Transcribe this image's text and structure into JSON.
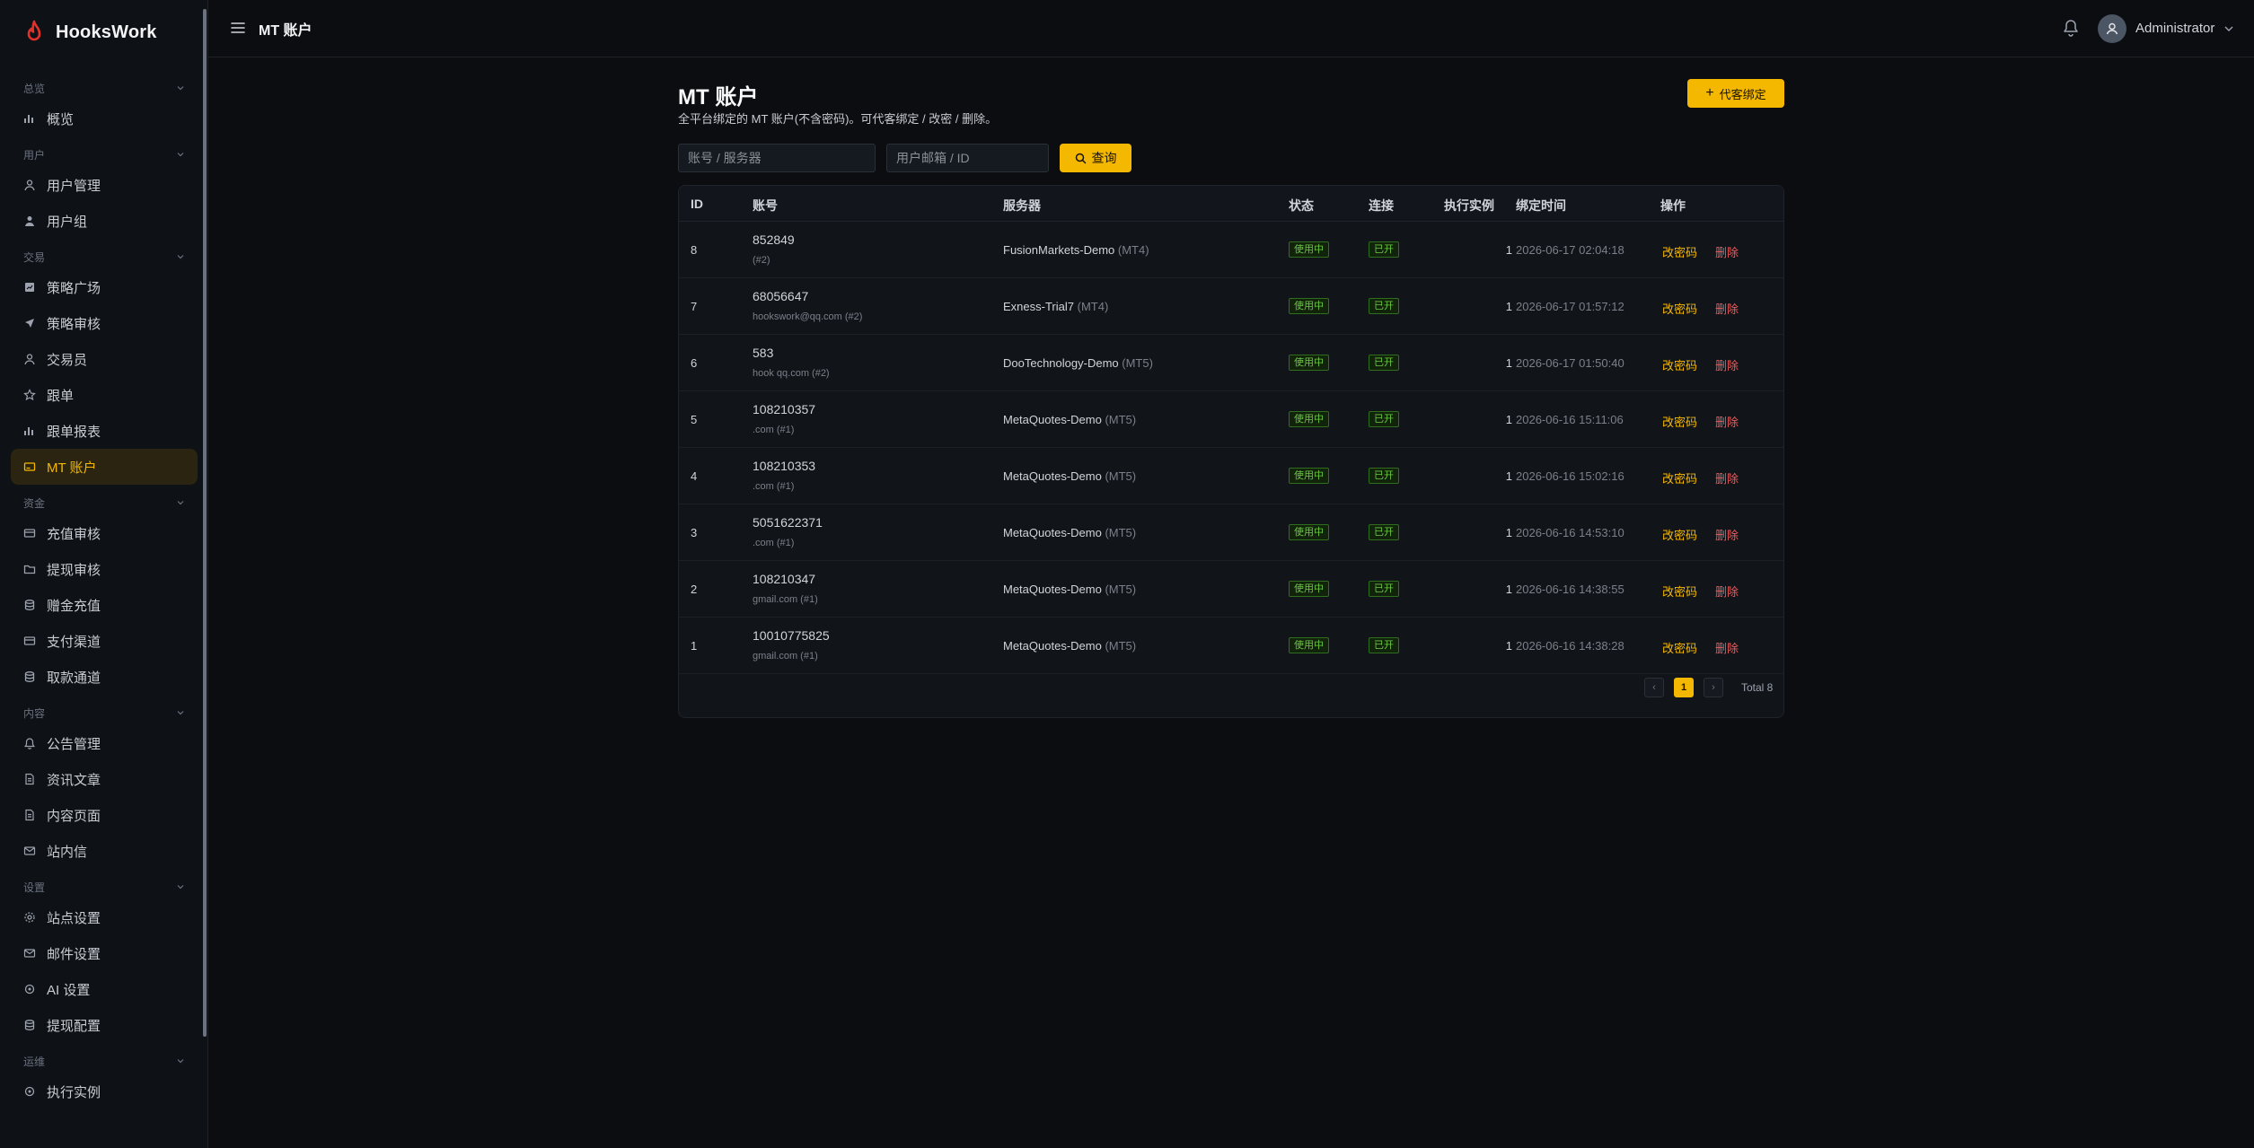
{
  "brand": {
    "name": "HooksWork"
  },
  "header": {
    "title": "MT 账户",
    "user": "Administrator"
  },
  "sidebar": {
    "groups": [
      {
        "title": "总览",
        "items": [
          {
            "label": "概览",
            "icon": "bar-chart-icon"
          }
        ]
      },
      {
        "title": "用户",
        "items": [
          {
            "label": "用户管理",
            "icon": "user-icon"
          },
          {
            "label": "用户组",
            "icon": "user-group-icon"
          }
        ]
      },
      {
        "title": "交易",
        "items": [
          {
            "label": "策略广场",
            "icon": "chart-square-icon"
          },
          {
            "label": "策略审核",
            "icon": "send-icon"
          },
          {
            "label": "交易员",
            "icon": "user-icon"
          },
          {
            "label": "跟单",
            "icon": "star-icon"
          },
          {
            "label": "跟单报表",
            "icon": "bar-chart-icon"
          },
          {
            "label": "MT 账户",
            "icon": "card-icon",
            "active": true
          }
        ]
      },
      {
        "title": "资金",
        "items": [
          {
            "label": "充值审核",
            "icon": "wallet-icon"
          },
          {
            "label": "提现审核",
            "icon": "folder-icon"
          },
          {
            "label": "赠金充值",
            "icon": "database-icon"
          },
          {
            "label": "支付渠道",
            "icon": "wallet-icon"
          },
          {
            "label": "取款通道",
            "icon": "database-icon"
          }
        ]
      },
      {
        "title": "内容",
        "items": [
          {
            "label": "公告管理",
            "icon": "bell-icon"
          },
          {
            "label": "资讯文章",
            "icon": "document-icon"
          },
          {
            "label": "内容页面",
            "icon": "document-icon"
          },
          {
            "label": "站内信",
            "icon": "mail-icon"
          }
        ]
      },
      {
        "title": "设置",
        "items": [
          {
            "label": "站点设置",
            "icon": "gear-icon"
          },
          {
            "label": "邮件设置",
            "icon": "mail-icon"
          },
          {
            "label": "AI 设置",
            "icon": "circle-icon"
          },
          {
            "label": "提现配置",
            "icon": "database-icon"
          }
        ]
      },
      {
        "title": "运维",
        "items": [
          {
            "label": "执行实例",
            "icon": "circle-icon"
          }
        ]
      }
    ]
  },
  "page": {
    "title": "MT 账户",
    "subtitle": "全平台绑定的 MT 账户(不含密码)。可代客绑定 / 改密 / 删除。",
    "proxy_bind_label": "代客绑定",
    "search": {
      "account_placeholder": "账号 / 服务器",
      "user_placeholder": "用户邮箱 / ID",
      "query_label": "查询"
    }
  },
  "table": {
    "columns": {
      "id": "ID",
      "account": "账号",
      "server": "服务器",
      "status": "状态",
      "connection": "连接",
      "instances": "执行实例",
      "bind_time": "绑定时间",
      "actions": "操作"
    },
    "rows": [
      {
        "id": "8",
        "account": "852849",
        "email": "(#2)",
        "server": "FusionMarkets-Demo",
        "ver": "(MT4)",
        "status": "使用中",
        "connection": "已开",
        "instances": "1",
        "time": "2026-06-17 02:04:18",
        "edit": "改密码",
        "delete": "删除"
      },
      {
        "id": "7",
        "account": "68056647",
        "email": "hookswork@qq.com (#2)",
        "server": "Exness-Trial7",
        "ver": "(MT4)",
        "status": "使用中",
        "connection": "已开",
        "instances": "1",
        "time": "2026-06-17 01:57:12",
        "edit": "改密码",
        "delete": "删除"
      },
      {
        "id": "6",
        "account": "583",
        "email": "hook qq.com (#2)",
        "server": "DooTechnology-Demo",
        "ver": "(MT5)",
        "status": "使用中",
        "connection": "已开",
        "instances": "1",
        "time": "2026-06-17 01:50:40",
        "edit": "改密码",
        "delete": "删除"
      },
      {
        "id": "5",
        "account": "108210357",
        "email": ".com (#1)",
        "server": "MetaQuotes-Demo",
        "ver": "(MT5)",
        "status": "使用中",
        "connection": "已开",
        "instances": "1",
        "time": "2026-06-16 15:11:06",
        "edit": "改密码",
        "delete": "删除"
      },
      {
        "id": "4",
        "account": "108210353",
        "email": ".com (#1)",
        "server": "MetaQuotes-Demo",
        "ver": "(MT5)",
        "status": "使用中",
        "connection": "已开",
        "instances": "1",
        "time": "2026-06-16 15:02:16",
        "edit": "改密码",
        "delete": "删除"
      },
      {
        "id": "3",
        "account": "5051622371",
        "email": ".com (#1)",
        "server": "MetaQuotes-Demo",
        "ver": "(MT5)",
        "status": "使用中",
        "connection": "已开",
        "instances": "1",
        "time": "2026-06-16 14:53:10",
        "edit": "改密码",
        "delete": "删除"
      },
      {
        "id": "2",
        "account": "108210347",
        "email": "gmail.com (#1)",
        "server": "MetaQuotes-Demo",
        "ver": "(MT5)",
        "status": "使用中",
        "connection": "已开",
        "instances": "1",
        "time": "2026-06-16 14:38:55",
        "edit": "改密码",
        "delete": "删除"
      },
      {
        "id": "1",
        "account": "10010775825",
        "email": "gmail.com (#1)",
        "server": "MetaQuotes-Demo",
        "ver": "(MT5)",
        "status": "使用中",
        "connection": "已开",
        "instances": "1",
        "time": "2026-06-16 14:38:28",
        "edit": "改密码",
        "delete": "删除"
      }
    ]
  },
  "pagination": {
    "current": "1",
    "total_text": "Total 8"
  },
  "colors": {
    "accent": "#f5b800",
    "danger": "#ef5b5b",
    "success": "#6cc644",
    "background": "#0b0d11"
  }
}
